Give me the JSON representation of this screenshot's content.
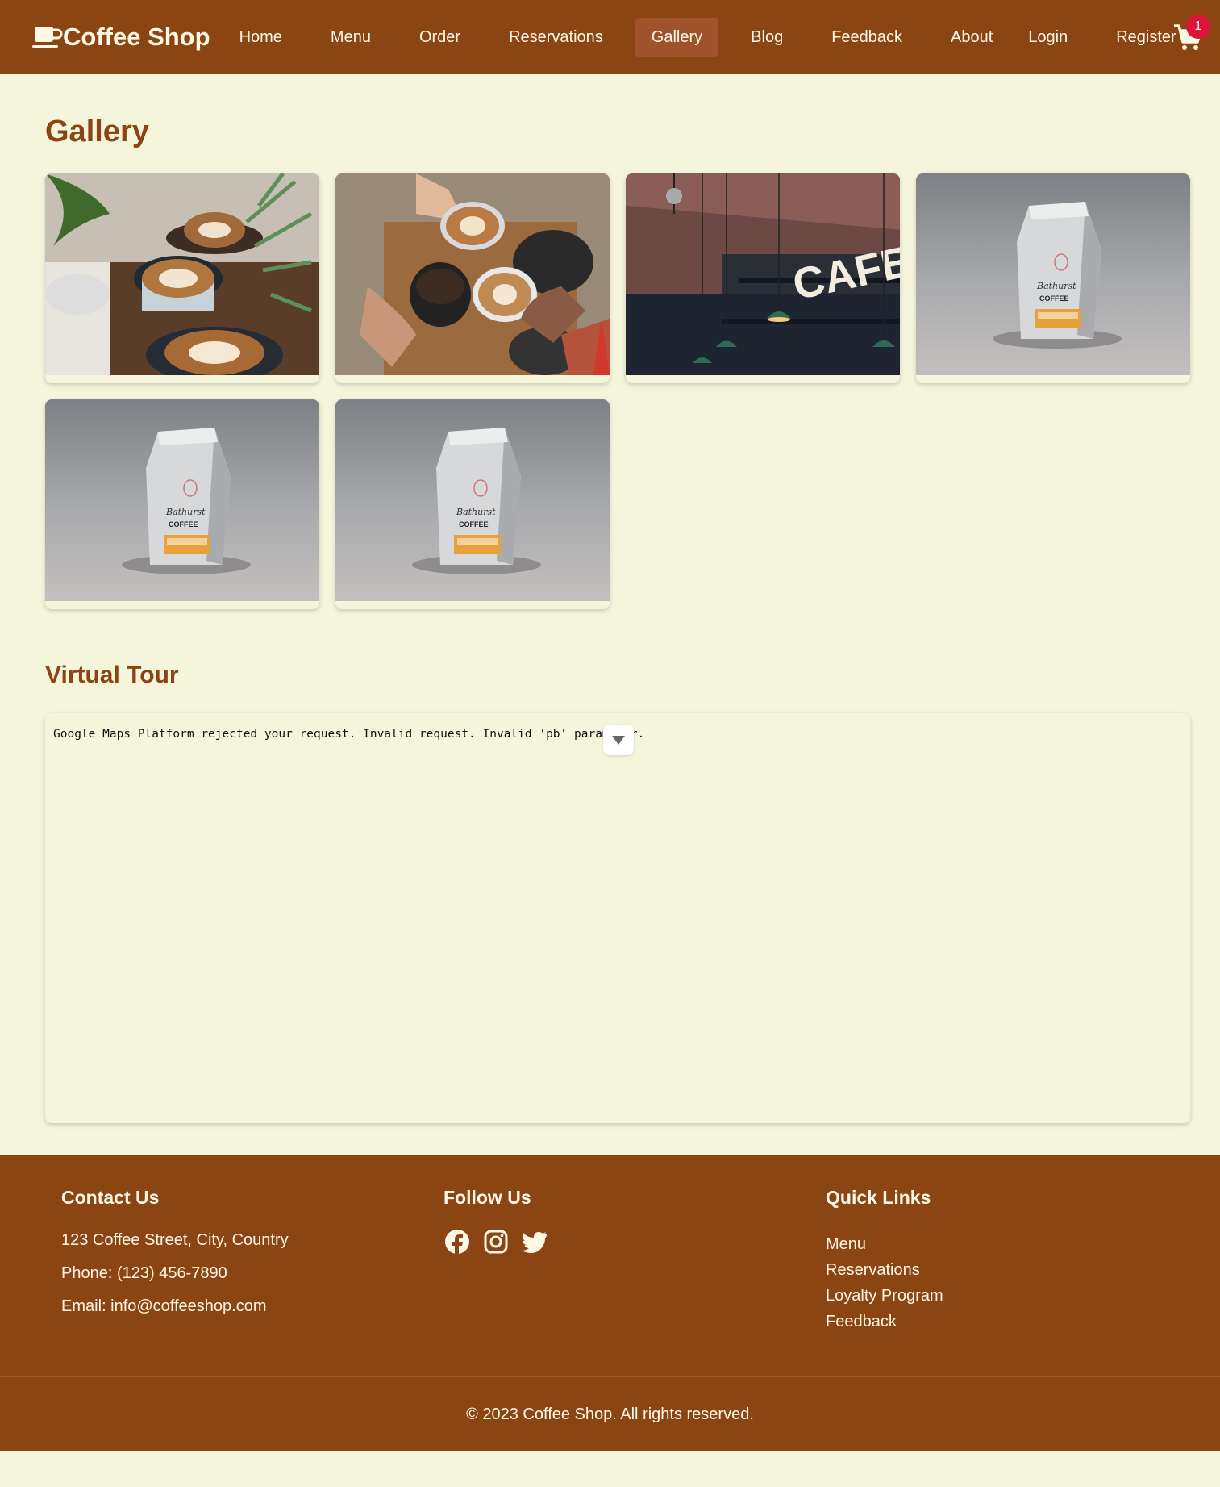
{
  "brand": {
    "name": "Coffee Shop",
    "icon": "coffee-cup-icon"
  },
  "nav": {
    "links": [
      "Home",
      "Menu",
      "Order",
      "Reservations",
      "Gallery",
      "Blog",
      "Feedback",
      "About",
      "Login",
      "Register"
    ],
    "active": "Gallery"
  },
  "cart": {
    "icon": "cart-icon",
    "count": "1"
  },
  "gallery": {
    "title": "Gallery",
    "images": [
      {
        "icon": "latte-cups-photo"
      },
      {
        "icon": "coffee-toast-photo"
      },
      {
        "icon": "cafe-sign-photo"
      },
      {
        "icon": "coffee-bag-photo"
      },
      {
        "icon": "coffee-bag-photo"
      },
      {
        "icon": "coffee-bag-photo"
      }
    ]
  },
  "tour": {
    "title": "Virtual Tour",
    "error": "Google Maps Platform rejected your request. Invalid request. Invalid 'pb' parameter."
  },
  "footer": {
    "contact": {
      "title": "Contact Us",
      "address": "123 Coffee Street, City, Country",
      "phone": "Phone: (123) 456-7890",
      "email": "Email: info@coffeeshop.com"
    },
    "follow": {
      "title": "Follow Us",
      "icons": [
        "facebook-icon",
        "instagram-icon",
        "twitter-icon"
      ]
    },
    "quick_links": {
      "title": "Quick Links",
      "links": [
        "Menu",
        "Reservations",
        "Loyalty Program",
        "Feedback"
      ]
    },
    "copyright": "© 2023 Coffee Shop. All rights reserved."
  },
  "colors": {
    "primary": "#8b4513",
    "active": "#a0522d",
    "background": "#f5f5dc",
    "badge": "#dc143c",
    "text_light": "#fff8e7"
  }
}
